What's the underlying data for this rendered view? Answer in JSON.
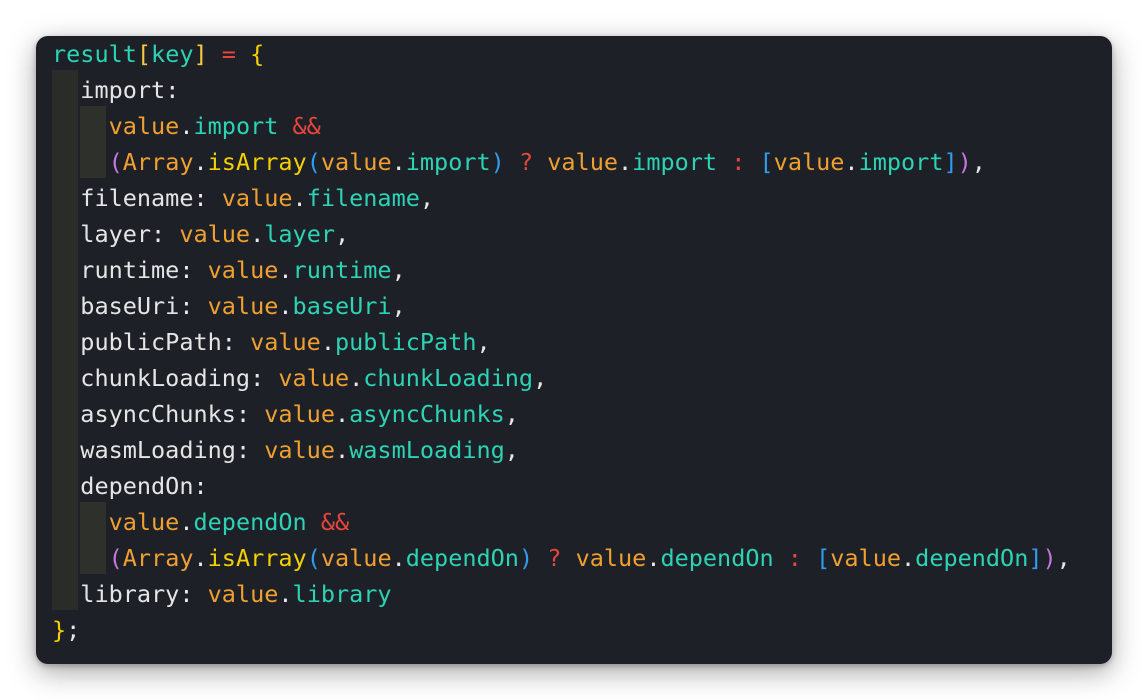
{
  "code": {
    "lines": [
      [
        {
          "t": "result",
          "c": "t-var"
        },
        {
          "t": "[",
          "c": "t-bracket"
        },
        {
          "t": "key",
          "c": "t-var"
        },
        {
          "t": "]",
          "c": "t-bracket"
        },
        {
          "t": " = ",
          "c": "t-op"
        },
        {
          "t": "{",
          "c": "t-brace"
        }
      ],
      [
        {
          "t": "  import",
          "c": "t-kw"
        },
        {
          "t": ":",
          "c": "t-punc"
        }
      ],
      [
        {
          "t": "    value",
          "c": "t-val"
        },
        {
          "t": ".",
          "c": "t-punc"
        },
        {
          "t": "import",
          "c": "t-prop"
        },
        {
          "t": " &&",
          "c": "t-op"
        }
      ],
      [
        {
          "t": "    ",
          "c": "t-punc"
        },
        {
          "t": "(",
          "c": "t-paren1"
        },
        {
          "t": "Array",
          "c": "t-arr"
        },
        {
          "t": ".",
          "c": "t-punc"
        },
        {
          "t": "isArray",
          "c": "t-fn"
        },
        {
          "t": "(",
          "c": "t-paren2"
        },
        {
          "t": "value",
          "c": "t-val"
        },
        {
          "t": ".",
          "c": "t-punc"
        },
        {
          "t": "import",
          "c": "t-prop"
        },
        {
          "t": ")",
          "c": "t-paren2"
        },
        {
          "t": " ? ",
          "c": "t-op"
        },
        {
          "t": "value",
          "c": "t-val"
        },
        {
          "t": ".",
          "c": "t-punc"
        },
        {
          "t": "import",
          "c": "t-prop"
        },
        {
          "t": " : ",
          "c": "t-op"
        },
        {
          "t": "[",
          "c": "t-paren2"
        },
        {
          "t": "value",
          "c": "t-val"
        },
        {
          "t": ".",
          "c": "t-punc"
        },
        {
          "t": "import",
          "c": "t-prop"
        },
        {
          "t": "]",
          "c": "t-paren2"
        },
        {
          "t": ")",
          "c": "t-paren1"
        },
        {
          "t": ",",
          "c": "t-punc"
        }
      ],
      [
        {
          "t": "  filename",
          "c": "t-kw"
        },
        {
          "t": ": ",
          "c": "t-punc"
        },
        {
          "t": "value",
          "c": "t-val"
        },
        {
          "t": ".",
          "c": "t-punc"
        },
        {
          "t": "filename",
          "c": "t-prop"
        },
        {
          "t": ",",
          "c": "t-punc"
        }
      ],
      [
        {
          "t": "  layer",
          "c": "t-kw"
        },
        {
          "t": ": ",
          "c": "t-punc"
        },
        {
          "t": "value",
          "c": "t-val"
        },
        {
          "t": ".",
          "c": "t-punc"
        },
        {
          "t": "layer",
          "c": "t-prop"
        },
        {
          "t": ",",
          "c": "t-punc"
        }
      ],
      [
        {
          "t": "  runtime",
          "c": "t-kw"
        },
        {
          "t": ": ",
          "c": "t-punc"
        },
        {
          "t": "value",
          "c": "t-val"
        },
        {
          "t": ".",
          "c": "t-punc"
        },
        {
          "t": "runtime",
          "c": "t-prop"
        },
        {
          "t": ",",
          "c": "t-punc"
        }
      ],
      [
        {
          "t": "  baseUri",
          "c": "t-kw"
        },
        {
          "t": ": ",
          "c": "t-punc"
        },
        {
          "t": "value",
          "c": "t-val"
        },
        {
          "t": ".",
          "c": "t-punc"
        },
        {
          "t": "baseUri",
          "c": "t-prop"
        },
        {
          "t": ",",
          "c": "t-punc"
        }
      ],
      [
        {
          "t": "  publicPath",
          "c": "t-kw"
        },
        {
          "t": ": ",
          "c": "t-punc"
        },
        {
          "t": "value",
          "c": "t-val"
        },
        {
          "t": ".",
          "c": "t-punc"
        },
        {
          "t": "publicPath",
          "c": "t-prop"
        },
        {
          "t": ",",
          "c": "t-punc"
        }
      ],
      [
        {
          "t": "  chunkLoading",
          "c": "t-kw"
        },
        {
          "t": ": ",
          "c": "t-punc"
        },
        {
          "t": "value",
          "c": "t-val"
        },
        {
          "t": ".",
          "c": "t-punc"
        },
        {
          "t": "chunkLoading",
          "c": "t-prop"
        },
        {
          "t": ",",
          "c": "t-punc"
        }
      ],
      [
        {
          "t": "  asyncChunks",
          "c": "t-kw"
        },
        {
          "t": ": ",
          "c": "t-punc"
        },
        {
          "t": "value",
          "c": "t-val"
        },
        {
          "t": ".",
          "c": "t-punc"
        },
        {
          "t": "asyncChunks",
          "c": "t-prop"
        },
        {
          "t": ",",
          "c": "t-punc"
        }
      ],
      [
        {
          "t": "  wasmLoading",
          "c": "t-kw"
        },
        {
          "t": ": ",
          "c": "t-punc"
        },
        {
          "t": "value",
          "c": "t-val"
        },
        {
          "t": ".",
          "c": "t-punc"
        },
        {
          "t": "wasmLoading",
          "c": "t-prop"
        },
        {
          "t": ",",
          "c": "t-punc"
        }
      ],
      [
        {
          "t": "  dependOn",
          "c": "t-kw"
        },
        {
          "t": ":",
          "c": "t-punc"
        }
      ],
      [
        {
          "t": "    value",
          "c": "t-val"
        },
        {
          "t": ".",
          "c": "t-punc"
        },
        {
          "t": "dependOn",
          "c": "t-prop"
        },
        {
          "t": " &&",
          "c": "t-op"
        }
      ],
      [
        {
          "t": "    ",
          "c": "t-punc"
        },
        {
          "t": "(",
          "c": "t-paren1"
        },
        {
          "t": "Array",
          "c": "t-arr"
        },
        {
          "t": ".",
          "c": "t-punc"
        },
        {
          "t": "isArray",
          "c": "t-fn"
        },
        {
          "t": "(",
          "c": "t-paren2"
        },
        {
          "t": "value",
          "c": "t-val"
        },
        {
          "t": ".",
          "c": "t-punc"
        },
        {
          "t": "dependOn",
          "c": "t-prop"
        },
        {
          "t": ")",
          "c": "t-paren2"
        },
        {
          "t": " ? ",
          "c": "t-op"
        },
        {
          "t": "value",
          "c": "t-val"
        },
        {
          "t": ".",
          "c": "t-punc"
        },
        {
          "t": "dependOn",
          "c": "t-prop"
        },
        {
          "t": " : ",
          "c": "t-op"
        },
        {
          "t": "[",
          "c": "t-paren2"
        },
        {
          "t": "value",
          "c": "t-val"
        },
        {
          "t": ".",
          "c": "t-punc"
        },
        {
          "t": "dependOn",
          "c": "t-prop"
        },
        {
          "t": "]",
          "c": "t-paren2"
        },
        {
          "t": ")",
          "c": "t-paren1"
        },
        {
          "t": ",",
          "c": "t-punc"
        }
      ],
      [
        {
          "t": "  library",
          "c": "t-kw"
        },
        {
          "t": ": ",
          "c": "t-punc"
        },
        {
          "t": "value",
          "c": "t-val"
        },
        {
          "t": ".",
          "c": "t-punc"
        },
        {
          "t": "library",
          "c": "t-prop"
        }
      ],
      [
        {
          "t": "}",
          "c": "t-brace"
        },
        {
          "t": ";",
          "c": "t-punc"
        }
      ]
    ]
  }
}
